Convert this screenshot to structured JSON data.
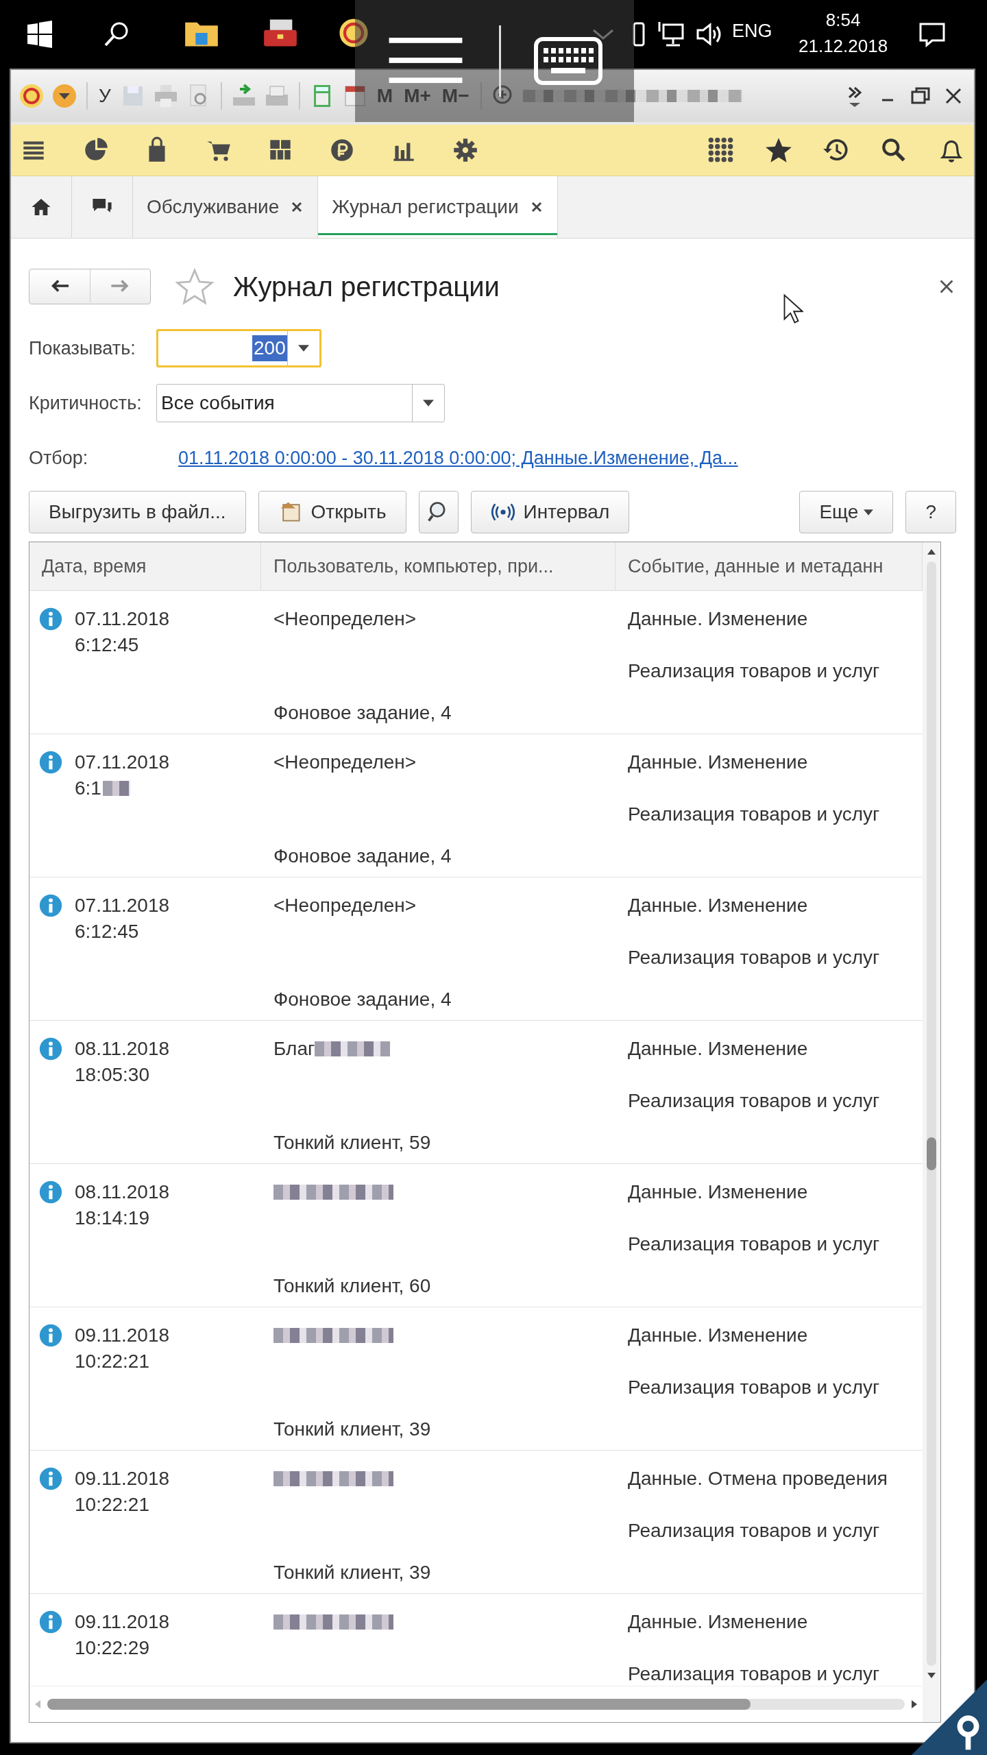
{
  "taskbar": {
    "language": "ENG",
    "time": "8:54",
    "date": "21.12.2018"
  },
  "app_toolbar": {
    "text_buttons": [
      {
        "label": "У",
        "disabled": false
      },
      {
        "label": "M",
        "disabled": true
      },
      {
        "label": "M+",
        "disabled": true
      },
      {
        "label": "M−",
        "disabled": true
      }
    ]
  },
  "tabs": [
    {
      "label": "Обслуживание",
      "selected": false
    },
    {
      "label": "Журнал регистрации",
      "selected": true
    }
  ],
  "form": {
    "title": "Журнал регистрации",
    "fields": [
      {
        "label": "Показывать:",
        "value": "200",
        "focused": true,
        "highlighted": true,
        "kind": "short"
      },
      {
        "label": "Критичность:",
        "value": "Все события",
        "focused": false,
        "highlighted": false,
        "kind": "long"
      }
    ],
    "filter": {
      "label": "Отбор:",
      "link": "01.11.2018 0:00:00 - 30.11.2018 0:00:00; Данные.Изменение, Да..."
    },
    "buttons": [
      {
        "label": "Выгрузить в файл...",
        "kind": "text"
      },
      {
        "label": "Открыть",
        "kind": "open"
      },
      {
        "kind": "find"
      },
      {
        "label": "Интервал",
        "kind": "interval"
      },
      {
        "label": "Еще",
        "kind": "more"
      },
      {
        "label": "?",
        "kind": "help"
      }
    ]
  },
  "table": {
    "columns": [
      "Дата, время",
      "Пользователь, компьютер, при...",
      "Событие, данные и метаданн"
    ],
    "rows": [
      {
        "date": "07.11.2018",
        "time": "6:12:45",
        "user": "<Неопределен>",
        "redacted": false,
        "session": "Фоновое задание, 4",
        "event": "Данные. Изменение",
        "object": "Реализация товаров и услуг"
      },
      {
        "date": "07.11.2018",
        "time": "6:1",
        "user": "<Неопределен>",
        "redacted": false,
        "session": "Фоновое задание, 4",
        "event": "Данные. Изменение",
        "object": "Реализация товаров и услуг"
      },
      {
        "date": "07.11.2018",
        "time": "6:12:45",
        "user": "<Неопределен>",
        "redacted": false,
        "session": "Фоновое задание, 4",
        "event": "Данные. Изменение",
        "object": "Реализация товаров и услуг"
      },
      {
        "date": "08.11.2018",
        "time": "18:05:30",
        "user": "Благ",
        "redacted": true,
        "session": "Тонкий клиент, 59",
        "event": "Данные. Изменение",
        "object": "Реализация товаров и услуг"
      },
      {
        "date": "08.11.2018",
        "time": "18:14:19",
        "redacted": true,
        "session": "Тонкий клиент, 60",
        "event": "Данные. Изменение",
        "object": "Реализация товаров и услуг"
      },
      {
        "date": "09.11.2018",
        "time": "10:22:21",
        "redacted": true,
        "session": "Тонкий клиент, 39",
        "event": "Данные. Изменение",
        "object": "Реализация товаров и услуг"
      },
      {
        "date": "09.11.2018",
        "time": "10:22:21",
        "redacted": true,
        "session": "Тонкий клиент, 39",
        "event": "Данные. Отмена проведения",
        "object": "Реализация товаров и услуг"
      },
      {
        "date": "09.11.2018",
        "time": "10:22:29",
        "redacted": true,
        "event": "Данные. Изменение",
        "object": "Реализация товаров и услуг"
      }
    ]
  }
}
